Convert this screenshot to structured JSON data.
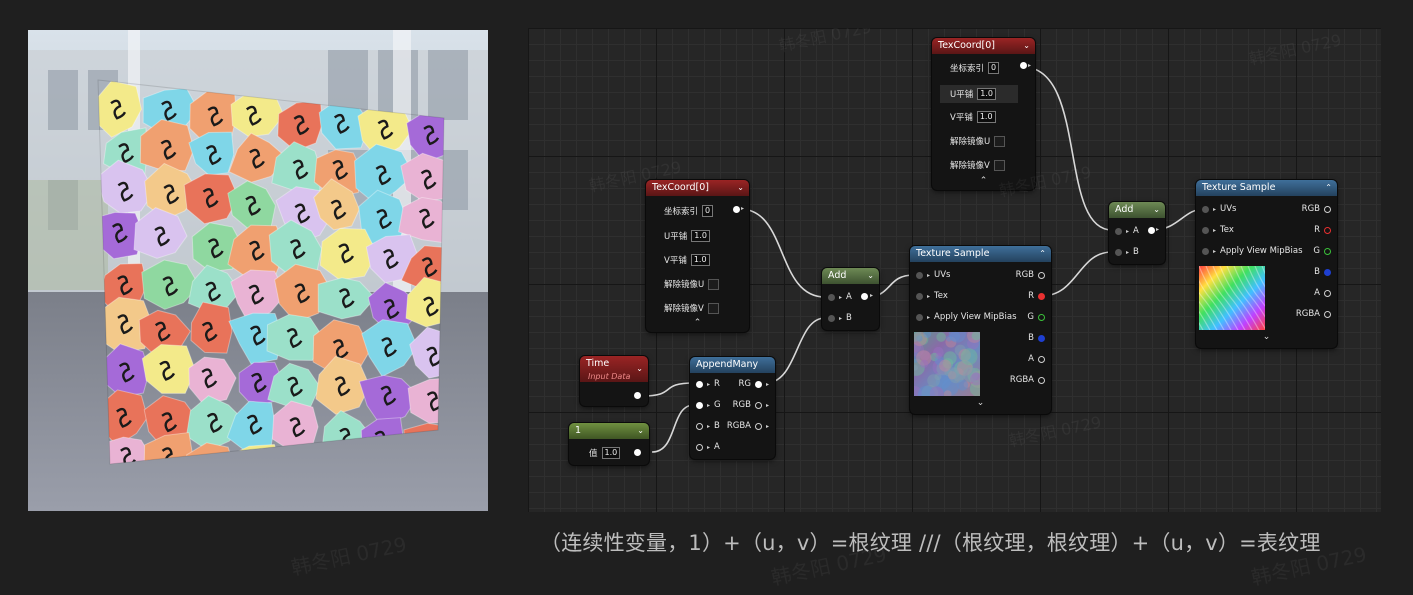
{
  "caption": "（连续性变量，1）+（u，v）=根纹理 ///（根纹理，根纹理）+（u，v）=表纹理",
  "watermark": "韩冬阳 0729",
  "nodes": {
    "texcoord_top": {
      "title": "TexCoord[0]",
      "coord_index_label": "坐标索引",
      "coord_index_value": "0",
      "u_tile_label": "U平铺",
      "u_tile_value": "1.0",
      "v_tile_label": "V平铺",
      "v_tile_value": "1.0",
      "unmirror_u_label": "解除镜像U",
      "unmirror_v_label": "解除镜像V"
    },
    "texcoord_left": {
      "title": "TexCoord[0]",
      "coord_index_label": "坐标索引",
      "coord_index_value": "0",
      "u_tile_label": "U平铺",
      "u_tile_value": "1.0",
      "v_tile_label": "V平铺",
      "v_tile_value": "1.0",
      "unmirror_u_label": "解除镜像U",
      "unmirror_v_label": "解除镜像V"
    },
    "time": {
      "title": "Time",
      "subtitle": "Input Data"
    },
    "constant": {
      "title": "1",
      "value_label": "值",
      "value": "1.0"
    },
    "append_many": {
      "title": "AppendMany",
      "inputs": [
        "R",
        "G",
        "B",
        "A"
      ],
      "outputs": [
        "RG",
        "RGB",
        "RGBA"
      ]
    },
    "add_left": {
      "title": "Add",
      "inputs": [
        "A",
        "B"
      ]
    },
    "add_right": {
      "title": "Add",
      "inputs": [
        "A",
        "B"
      ]
    },
    "texture_sample_mid": {
      "title": "Texture Sample",
      "inputs": [
        "UVs",
        "Tex",
        "Apply View MipBias"
      ],
      "outputs": [
        "RGB",
        "R",
        "G",
        "B",
        "A",
        "RGBA"
      ]
    },
    "texture_sample_right": {
      "title": "Texture Sample",
      "inputs": [
        "UVs",
        "Tex",
        "Apply View MipBias"
      ],
      "outputs": [
        "RGB",
        "R",
        "G",
        "B",
        "A",
        "RGBA"
      ]
    }
  },
  "icons": {
    "collapse": "chevron-up-icon",
    "expand": "chevron-down-icon",
    "dropdown": "chevron-down-icon"
  },
  "colors": {
    "texcoord_header": "#9a2424",
    "texture_header": "#3f6f9a",
    "add_header": "#6e8a55",
    "constant_header": "#6f9040",
    "graph_bg": "#262626",
    "page_bg": "#1f1f1f"
  }
}
